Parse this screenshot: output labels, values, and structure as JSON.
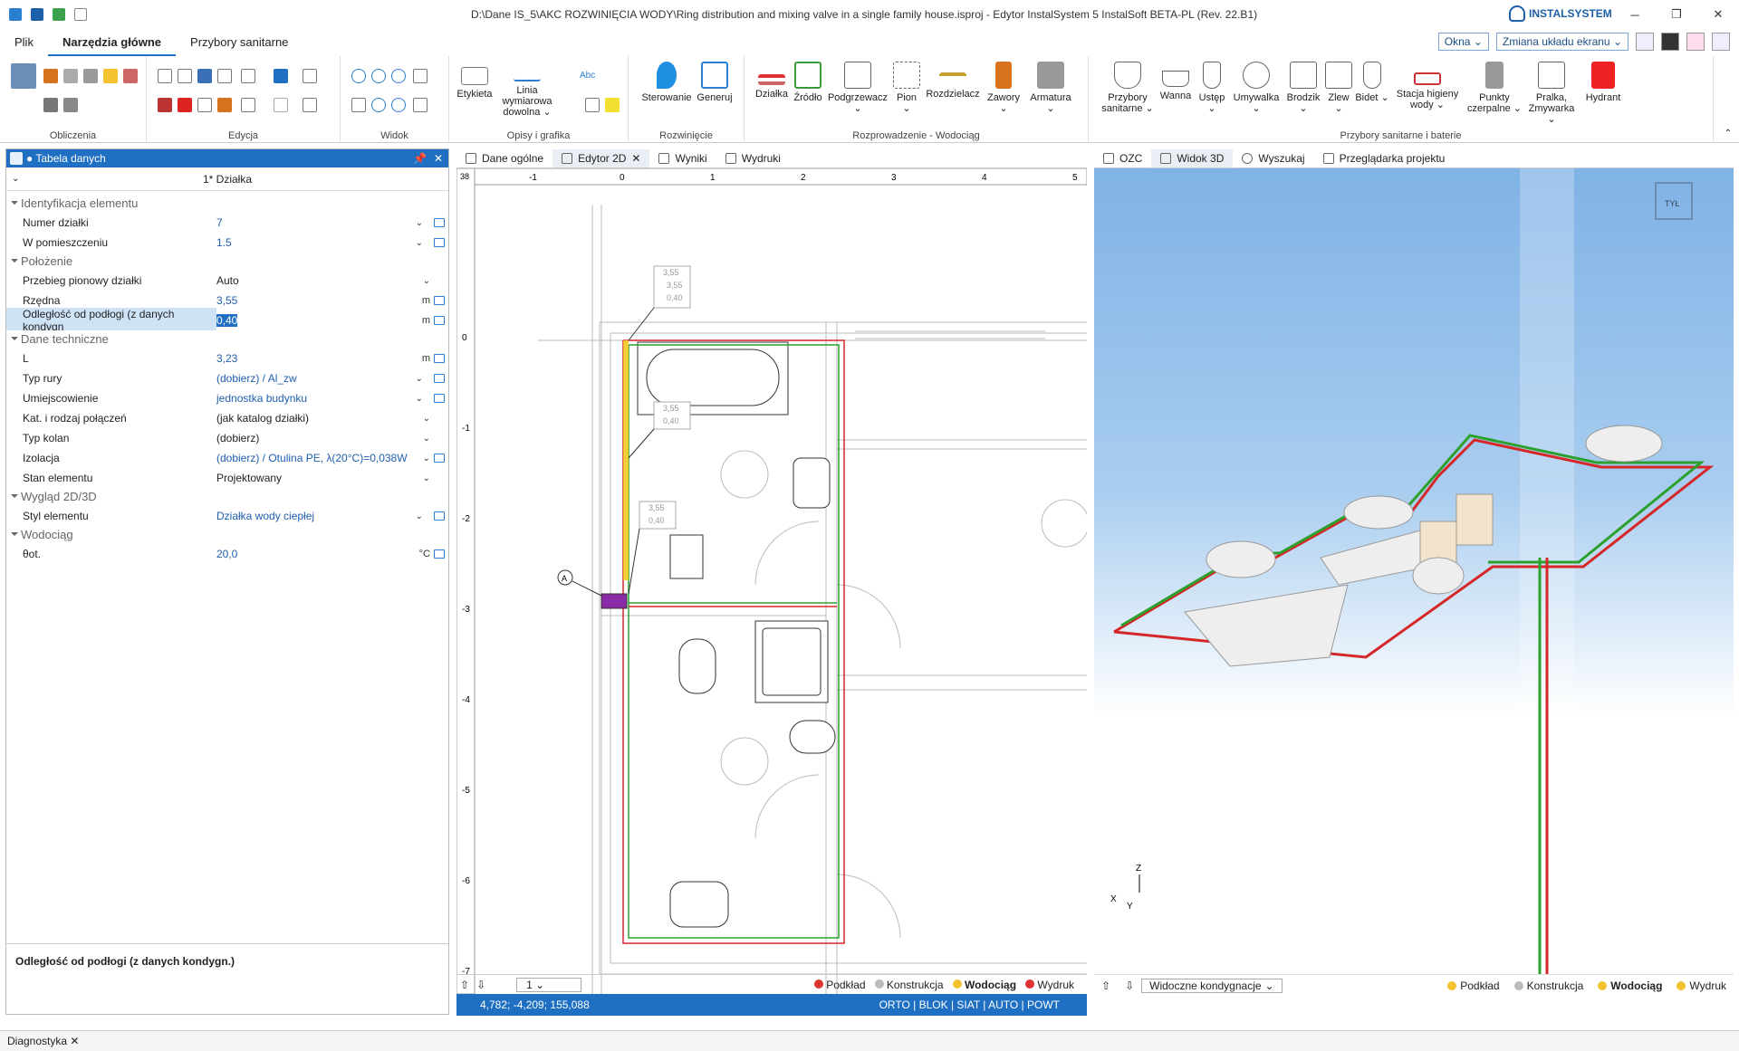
{
  "window": {
    "title": "D:\\Dane IS_5\\AKC ROZWINIĘCIA WODY\\Ring distribution and mixing valve in a single family house.isproj - Edytor InstalSystem 5 InstalSoft BETA-PL (Rev. 22.B1)",
    "brand": "INSTALSYSTEM"
  },
  "menu": [
    "Plik",
    "Narzędzia główne",
    "Przybory sanitarne"
  ],
  "top_buttons": {
    "okna": "Okna",
    "zmiana": "Zmiana układu ekranu"
  },
  "ribbon_groups": [
    {
      "label": "Obliczenia"
    },
    {
      "label": "Edycja"
    },
    {
      "label": "Widok"
    },
    {
      "label": "Opisy i grafika"
    },
    {
      "label": "Rozwinięcie"
    },
    {
      "label": "Rozprowadzenie - Wodociąg"
    },
    {
      "label": "Przybory sanitarne i baterie"
    }
  ],
  "ribbon_buttons": {
    "etykieta": "Etykieta",
    "linia": "Linia wymiarowa dowolna",
    "sterowanie": "Sterowanie",
    "generuj": "Generuj",
    "dzialka": "Działka",
    "zrodlo": "Źródło",
    "podgrzewacz": "Podgrzewacz",
    "pion": "Pion",
    "rozdzielacz": "Rozdzielacz",
    "zawory": "Zawory",
    "armatura": "Armatura",
    "przybory": "Przybory sanitarne",
    "wanna": "Wanna",
    "ustep": "Ustęp",
    "umywalka": "Umywalka",
    "brodzik": "Brodzik",
    "zlew": "Zlew",
    "bidet": "Bidet",
    "stacja": "Stacja higieny wody",
    "punkty": "Punkty czerpalne",
    "pralka": "Pralka, Zmywarka",
    "hydrant": "Hydrant",
    "abc": "Abc"
  },
  "data_table": {
    "title": "Tabela danych",
    "object": "1* Działka",
    "categories": {
      "ident": "Identyfikacja elementu",
      "polozenie": "Położenie",
      "dane": "Dane techniczne",
      "wyglad": "Wygląd 2D/3D",
      "wodociag": "Wodociąg"
    },
    "rows": {
      "numer": {
        "name": "Numer działki",
        "value": "7"
      },
      "pom": {
        "name": "W pomieszczeniu",
        "value": "1.5"
      },
      "przebieg": {
        "name": "Przebieg pionowy działki",
        "value": "Auto"
      },
      "rzedna": {
        "name": "Rzędna",
        "value": "3,55",
        "unit": "m"
      },
      "odl": {
        "name": "Odległość od podłogi (z danych kondygn",
        "value": "0,40",
        "unit": "m"
      },
      "L": {
        "name": "L",
        "value": "3,23",
        "unit": "m"
      },
      "typ": {
        "name": "Typ rury",
        "value": "(dobierz) / Al_zw"
      },
      "umiejsc": {
        "name": "Umiejscowienie",
        "value": "jednostka budynku"
      },
      "kat": {
        "name": "Kat. i rodzaj połączeń",
        "value": "(jak katalog działki)"
      },
      "kolan": {
        "name": "Typ kolan",
        "value": "(dobierz)"
      },
      "izol": {
        "name": "Izolacja",
        "value": "(dobierz) / Otulina PE, λ(20°C)=0,038W"
      },
      "stan": {
        "name": "Stan elementu",
        "value": "Projektowany"
      },
      "styl": {
        "name": "Styl elementu",
        "value": "Działka wody ciepłej"
      },
      "theta": {
        "name": "θot.",
        "value": "20,0",
        "unit": "°C"
      }
    },
    "description": "Odległość od podłogi (z danych kondygn.)"
  },
  "mid_tabs": [
    "Dane ogólne",
    "Edytor 2D",
    "Wyniki",
    "Wydruki"
  ],
  "right_tabs": [
    "OZC",
    "Widok 3D",
    "Wyszukaj",
    "Przeglądarka projektu"
  ],
  "layers": [
    "Podkład",
    "Konstrukcja",
    "Wodociąg",
    "Wydruk"
  ],
  "layer_combo": "1",
  "status": {
    "coords": "4,782; -4,209; 155,088",
    "modes": "ORTO | BLOK | SIAT | AUTO | POWT"
  },
  "view3d": {
    "combo": "Widoczne kondygnacje",
    "cube": "TYŁ",
    "axis_z": "Z",
    "axis_x": "X",
    "axis_y": "Y"
  },
  "diag": "Diagnostyka",
  "ruler": {
    "h": [
      "-1",
      "0",
      "1",
      "2",
      "3",
      "4",
      "5"
    ],
    "v": [
      "0",
      "-1",
      "-2",
      "-3",
      "-4",
      "-5",
      "-6",
      "-7"
    ],
    "corner": "38"
  },
  "labels2d": {
    "a": "3,55",
    "b": "3,55",
    "c": "0,40",
    "d": "3,55",
    "e": "0,40",
    "f": "3,55",
    "g": "0,40",
    "marker": "A"
  }
}
